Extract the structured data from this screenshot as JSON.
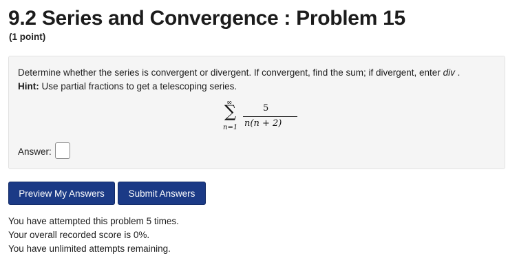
{
  "header": {
    "title": "9.2 Series and Convergence : Problem 15",
    "points": "(1 point)"
  },
  "problem": {
    "question_prefix": "Determine whether the series is convergent or divergent. If convergent, find the sum; if divergent, enter",
    "div_word": "div",
    "question_suffix": ".",
    "hint_label": "Hint:",
    "hint_text": " Use partial fractions to get a telescoping series.",
    "series": {
      "sigma": "∑",
      "upper": "∞",
      "lower": "n=1",
      "numerator": "5",
      "denominator": "n(n + 2)"
    },
    "answer_label": "Answer:",
    "answer_value": ""
  },
  "buttons": {
    "preview": "Preview My Answers",
    "submit": "Submit Answers"
  },
  "status": {
    "attempts": "You have attempted this problem 5 times.",
    "score": "Your overall recorded score is 0%.",
    "remaining": "You have unlimited attempts remaining."
  }
}
